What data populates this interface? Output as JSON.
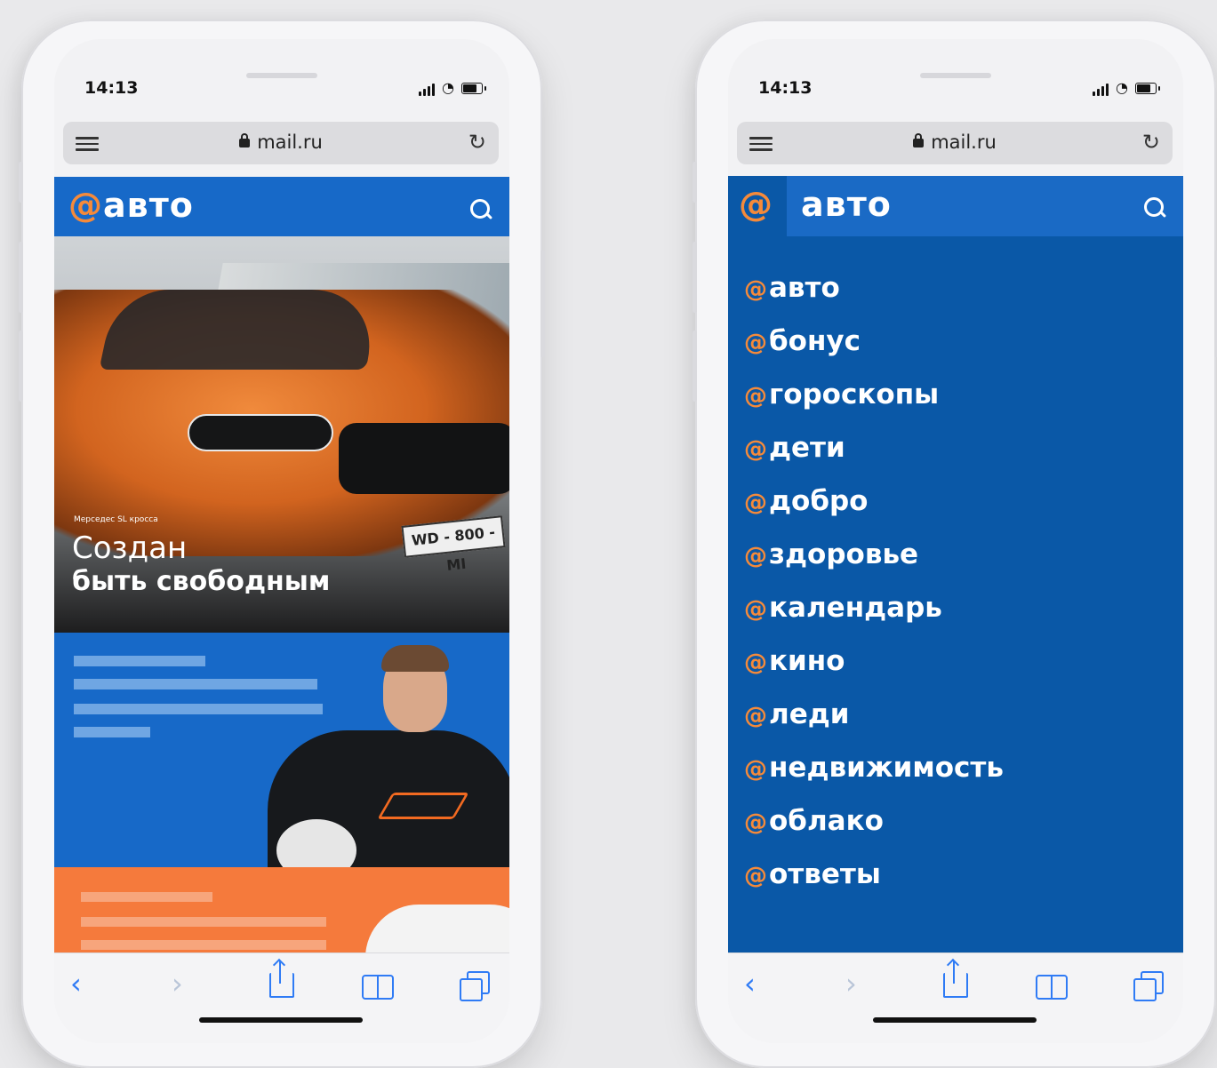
{
  "status": {
    "time": "14:13"
  },
  "browser": {
    "url": "mail.ru"
  },
  "site": {
    "logo_at": "@",
    "logo_text": "авто"
  },
  "hero": {
    "small_caption": "Мерседес SL кросса",
    "title_line1": "Создан",
    "title_line2": "быть свободным",
    "plate": "WD - 800 - MI"
  },
  "menu": {
    "at": "@",
    "title": "авто",
    "items": [
      "авто",
      "бонус",
      "гороскопы",
      "дети",
      "добро",
      "здоровье",
      "календарь",
      "кино",
      "леди",
      "недвижимость",
      "облако",
      "ответы"
    ]
  },
  "toolbar": {
    "back": "‹",
    "forward": "›"
  },
  "colors": {
    "brand_blue": "#1769c8",
    "menu_blue": "#0a58a7",
    "accent_orange": "#f58a3a",
    "ios_blue": "#2f7bf5"
  }
}
